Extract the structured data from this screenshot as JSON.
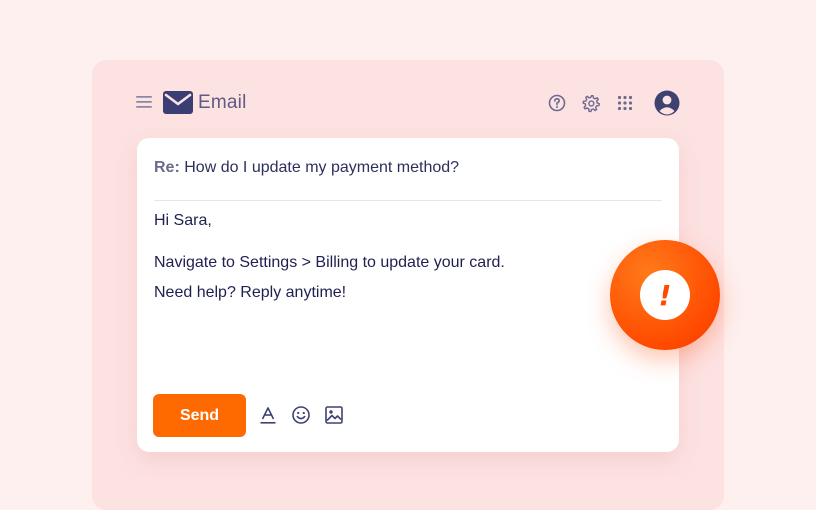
{
  "app": {
    "title": "Email"
  },
  "header_icons": [
    "menu-icon",
    "mail-logo-icon",
    "help-icon",
    "gear-icon",
    "apps-grid-icon",
    "avatar-icon"
  ],
  "email": {
    "subject_prefix": "Re:",
    "subject": "How do I update my payment method?",
    "greeting": "Hi Sara,",
    "body_lines": [
      "Navigate to Settings > Billing to update your card.",
      "Need help? Reply anytime!"
    ]
  },
  "toolbar": {
    "send_label": "Send",
    "icons": [
      "text-format-icon",
      "emoji-icon",
      "image-icon"
    ]
  },
  "alert": {
    "glyph": "!"
  },
  "colors": {
    "background": "#fdf0ef",
    "panel": "#fde2e2",
    "accent": "#ff6a00",
    "alert": "#ff4a00",
    "navy": "#2d2f5c",
    "logo": "#3b3e72"
  }
}
